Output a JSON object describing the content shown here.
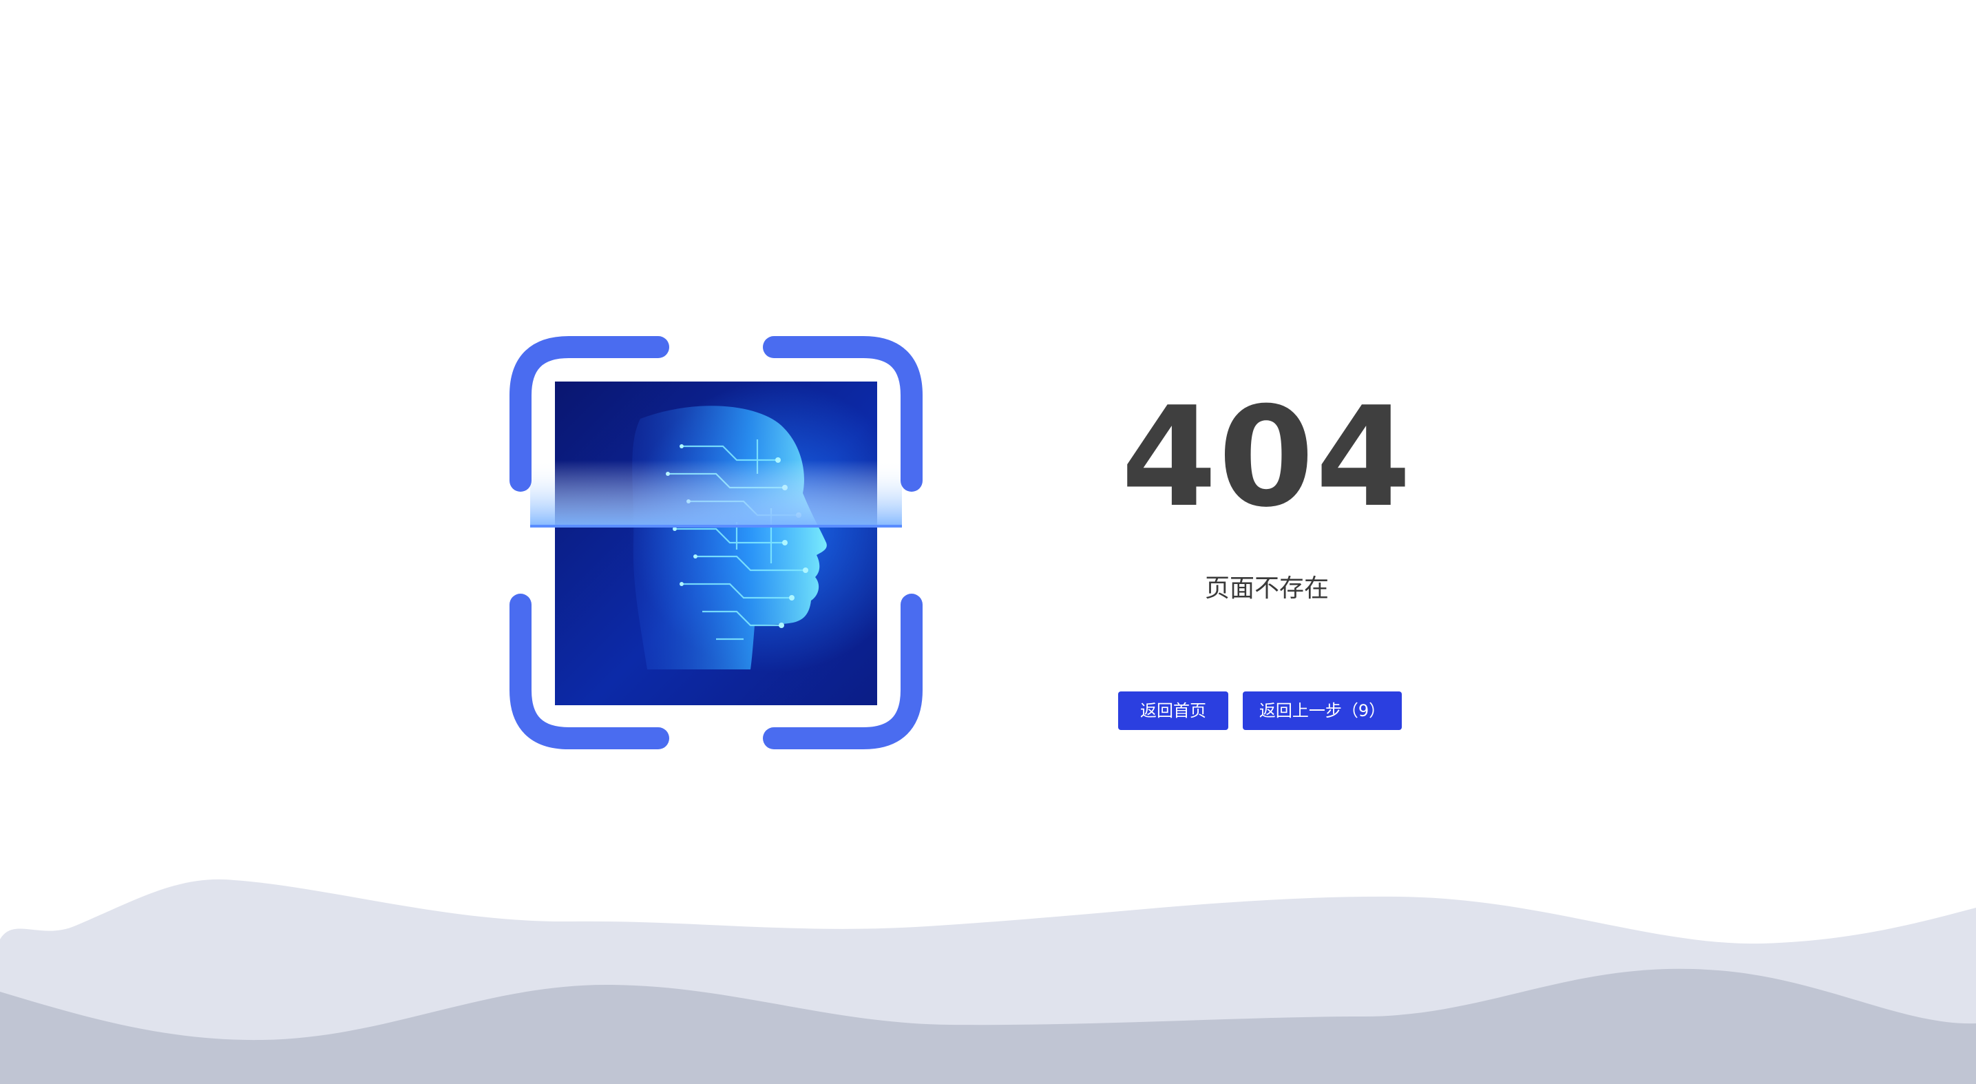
{
  "error": {
    "code": "404",
    "message": "页面不存在"
  },
  "actions": {
    "home_label": "返回首页",
    "back_label": "返回上一步（9）"
  },
  "colors": {
    "primary_button": "#2b3fe0",
    "bracket": "#4a6cf0",
    "code_text": "#3f3f3f",
    "wave_light": "#e0e3ed",
    "wave_dark": "#c0c5d3"
  },
  "icons": {
    "illustration": "face-scan-icon"
  }
}
